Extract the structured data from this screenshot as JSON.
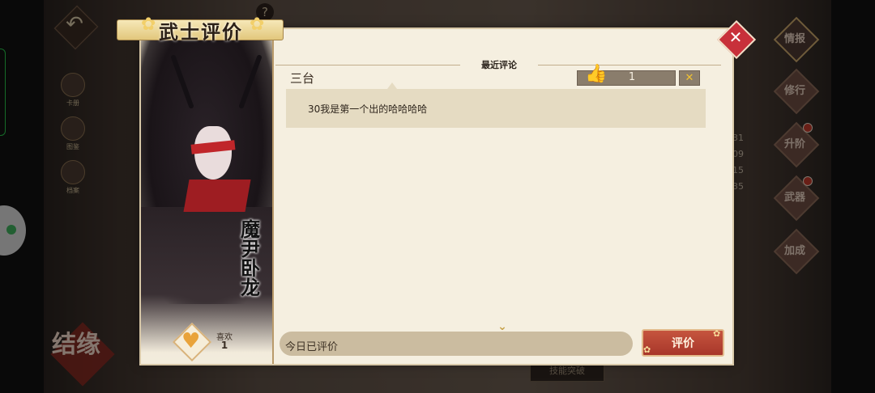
{
  "dialog": {
    "title": "武士评价",
    "section_title": "最近评论",
    "close_icon": "close-x-icon"
  },
  "character": {
    "name": "魔尹卧龙",
    "like_label": "喜欢",
    "like_count": "1",
    "like_icon": "heart-icon"
  },
  "comments": [
    {
      "author": "三台",
      "likes": "1",
      "text": "30我是第一个出的哈哈哈哈",
      "like_icon": "thumbs-up-icon",
      "report_icon": "report-x-icon"
    }
  ],
  "input": {
    "text": "今日已评价"
  },
  "submit": {
    "label": "评价"
  },
  "background": {
    "right_menu": [
      "情报",
      "修行",
      "升阶",
      "武器",
      "加成"
    ],
    "left_menu": [
      "卡册",
      "图鉴",
      "档案"
    ],
    "numbers": [
      "31",
      "09",
      "15",
      "35"
    ],
    "jieyuan": "结缘",
    "bottom_button": "技能突破"
  },
  "colors": {
    "accent_red": "#c6553e",
    "comment_bg": "#e5dbc2",
    "dialog_bg": "#f5efe0",
    "like_gold": "#f0a321"
  }
}
